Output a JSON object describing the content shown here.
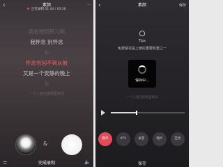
{
  "left": {
    "header": {
      "back_icon": "chevron-left-icon",
      "title": "素颜",
      "recording_label": "正在录制",
      "time": "01:44 / 03:56",
      "right_icon": "more-icon"
    },
    "lyrics": [
      {
        "text": "我是想到那儿啊",
        "state": "dim"
      },
      {
        "text": "我怀念 别怀念",
        "state": "normal"
      },
      {
        "text": "&",
        "state": "dim"
      },
      {
        "text": "怀念也回不到从前",
        "state": "active"
      },
      {
        "text": "又是一个安静的晚上",
        "state": "normal"
      },
      {
        "text": "&",
        "state": "dim"
      },
      {
        "text": "一个人窝在摇椅里乘凉",
        "state": "small"
      }
    ],
    "ampersand": "&",
    "bottom": {
      "tune_icon": "tune-icon",
      "finish_label": "完成录制",
      "volume_icon": "volume-icon"
    }
  },
  "right": {
    "header": {
      "back_icon": "chevron-left-icon",
      "title": "素颜",
      "right_label": "保存"
    },
    "tips": {
      "icon": "lightbulb-icon",
      "title": "Tips",
      "text": "免费解花是上榜的重要权重之一"
    },
    "loading": {
      "label": "保存中..."
    },
    "lyric": "一个人窝在摇椅里乘凉",
    "player": {
      "progress": 0.35
    },
    "effects": [
      {
        "label": "原声",
        "selected": true
      },
      {
        "label": "KTV",
        "selected": false
      },
      {
        "label": "录音",
        "selected": false
      },
      {
        "label": "唱片",
        "selected": false
      },
      {
        "label": "空灵",
        "selected": false
      }
    ],
    "save_label": "保存"
  }
}
